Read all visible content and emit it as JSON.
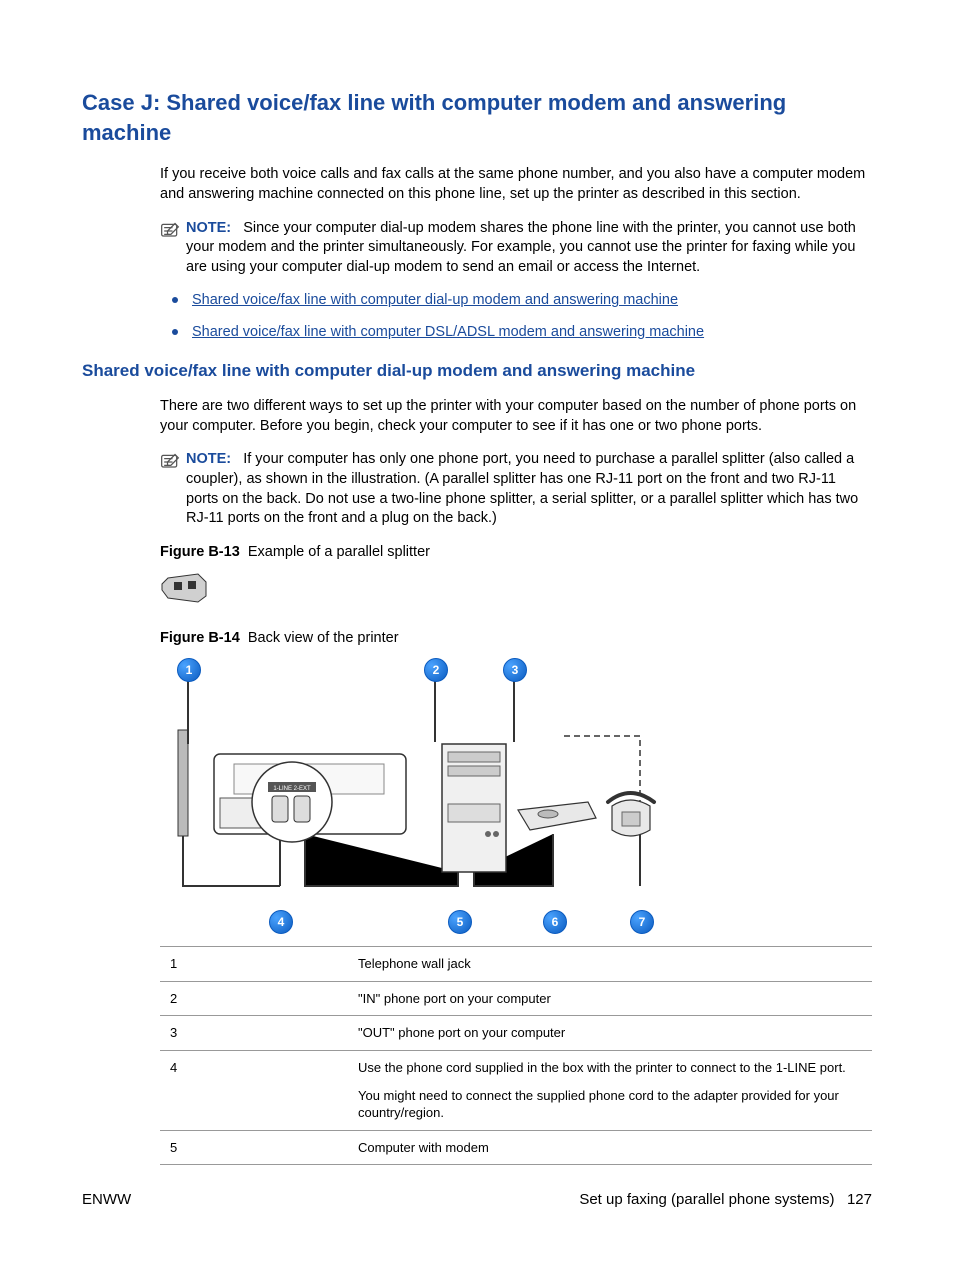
{
  "heading": "Case J: Shared voice/fax line with computer modem and answering machine",
  "intro": "If you receive both voice calls and fax calls at the same phone number, and you also have a computer modem and answering machine connected on this phone line, set up the printer as described in this section.",
  "note1_label": "NOTE:",
  "note1_text": "Since your computer dial-up modem shares the phone line with the printer, you cannot use both your modem and the printer simultaneously. For example, you cannot use the printer for faxing while you are using your computer dial-up modem to send an email or access the Internet.",
  "links": [
    "Shared voice/fax line with computer dial-up modem and answering machine",
    "Shared voice/fax line with computer DSL/ADSL modem and answering machine"
  ],
  "subheading": "Shared voice/fax line with computer dial-up modem and answering machine",
  "para2": "There are two different ways to set up the printer with your computer based on the number of phone ports on your computer. Before you begin, check your computer to see if it has one or two phone ports.",
  "note2_label": "NOTE:",
  "note2_text": "If your computer has only one phone port, you need to purchase a parallel splitter (also called a coupler), as shown in the illustration. (A parallel splitter has one RJ-11 port on the front and two RJ-11 ports on the back. Do not use a two-line phone splitter, a serial splitter, or a parallel splitter which has two RJ-11 ports on the front and a plug on the back.)",
  "fig13_label": "Figure B-13",
  "fig13_text": "Example of a parallel splitter",
  "fig14_label": "Figure B-14",
  "fig14_text": "Back view of the printer",
  "diagram_port_label": "1-LINE 2-EXT",
  "callouts": [
    "1",
    "2",
    "3",
    "4",
    "5",
    "6",
    "7"
  ],
  "table": [
    {
      "num": "1",
      "desc": "Telephone wall jack"
    },
    {
      "num": "2",
      "desc": "\"IN\" phone port on your computer"
    },
    {
      "num": "3",
      "desc": "\"OUT\" phone port on your computer"
    },
    {
      "num": "4",
      "desc_a": "Use the phone cord supplied in the box with the printer to connect to the 1-LINE port.",
      "desc_b": "You might need to connect the supplied phone cord to the adapter provided for your country/region."
    },
    {
      "num": "5",
      "desc": "Computer with modem"
    }
  ],
  "footer_left": "ENWW",
  "footer_right_text": "Set up faxing (parallel phone systems)",
  "footer_page": "127"
}
